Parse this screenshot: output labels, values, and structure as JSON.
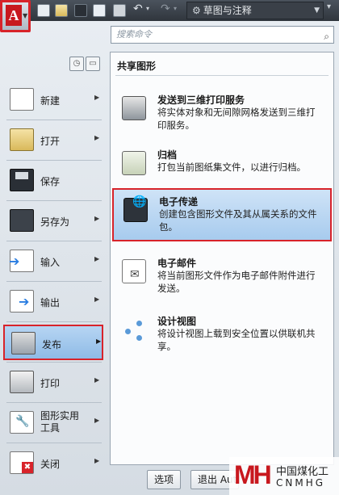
{
  "toolbar": {
    "app_icon": "autocad-logo-icon",
    "app_logo_text": "A",
    "workspace": "草图与注释",
    "icons": [
      "new-icon",
      "open-icon",
      "save-icon",
      "saveas-icon",
      "print-icon",
      "undo-icon",
      "redo-icon"
    ]
  },
  "search": {
    "placeholder": "搜索命令"
  },
  "left_menu": {
    "items": [
      {
        "label": "新建"
      },
      {
        "label": "打开"
      },
      {
        "label": "保存"
      },
      {
        "label": "另存为"
      },
      {
        "label": "输入"
      },
      {
        "label": "输出"
      },
      {
        "label": "发布"
      },
      {
        "label": "打印"
      },
      {
        "label": "图形实用",
        "label2": "工具"
      },
      {
        "label": "关闭"
      }
    ]
  },
  "publish_panel": {
    "title": "共享图形",
    "options": [
      {
        "title": "发送到三维打印服务",
        "desc": "将实体对象和无间隙网格发送到三维打印服务。"
      },
      {
        "title": "归档",
        "desc": "打包当前图纸集文件，以进行归档。"
      },
      {
        "title": "电子传递",
        "desc": "创建包含图形文件及其从属关系的文件包。"
      },
      {
        "title": "电子邮件",
        "desc": "将当前图形文件作为电子邮件附件进行发送。"
      },
      {
        "title": "设计视图",
        "desc": "将设计视图上载到安全位置以供联机共享。"
      }
    ]
  },
  "bottom": {
    "options_label": "选项",
    "exit_label": "退出 Auto"
  },
  "watermark": {
    "mark": "MH",
    "cn": "中国煤化工",
    "en": "CNMHG"
  },
  "colors": {
    "highlight_border": "#d8232a",
    "selected_fill": "#a7cbee"
  }
}
